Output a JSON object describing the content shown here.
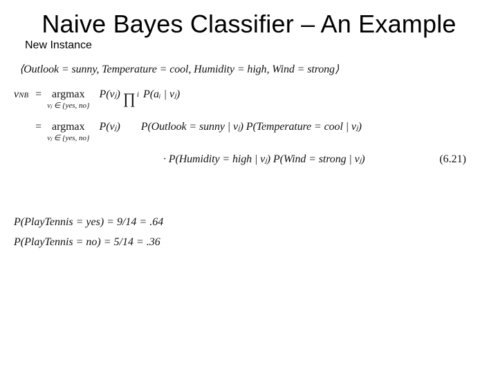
{
  "title": "Naive Bayes Classifier – An Example",
  "subhead": "New Instance",
  "instance_tuple": "⟨Outlook = sunny, Temperature = cool, Humidity = high, Wind = strong⟩",
  "nb_lhs": "v",
  "nb_lhs_sub": "NB",
  "argmax_label": "argmax",
  "argmax_domain": "vⱼ ∈ {yes, no}",
  "pvj": "P(vⱼ)",
  "pai_given_vj": "P(aᵢ | vⱼ)",
  "expanded_line1": "P(Outlook = sunny | vⱼ) P(Temperature = cool | vⱼ)",
  "expanded_line2": "· P(Humidity = high | vⱼ) P(Wind = strong | vⱼ)",
  "equation_number": "(6.21)",
  "prior_yes": "P(PlayTennis = yes) = 9/14 = .64",
  "prior_no": "P(PlayTennis = no) = 5/14 = .36",
  "chart_data": {
    "type": "table",
    "title": "Naive Bayes example – priors and instance",
    "instance": {
      "Outlook": "sunny",
      "Temperature": "cool",
      "Humidity": "high",
      "Wind": "strong"
    },
    "decision_rule": "v_NB = argmax_{v_j in {yes,no}} P(v_j) * Prod_i P(a_i | v_j)",
    "priors": [
      {
        "class": "yes",
        "fraction": "9/14",
        "value": 0.64
      },
      {
        "class": "no",
        "fraction": "5/14",
        "value": 0.36
      }
    ],
    "equation_ref": "6.21"
  }
}
